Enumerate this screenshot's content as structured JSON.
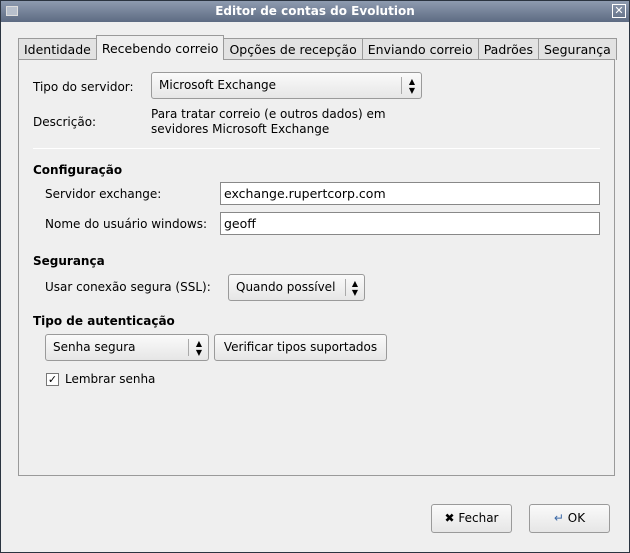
{
  "window": {
    "title": "Editor de contas do Evolution"
  },
  "tabs": [
    "Identidade",
    "Recebendo correio",
    "Opções de recepção",
    "Enviando correio",
    "Padrões",
    "Segurança"
  ],
  "server": {
    "label": "Tipo do servidor:",
    "value": "Microsoft Exchange",
    "desc_label": "Descrição:",
    "desc_line1": "Para tratar correio (e outros dados) em",
    "desc_line2": "sevidores Microsoft Exchange"
  },
  "config": {
    "heading": "Configuração",
    "server_label": "Servidor exchange:",
    "server_value": "exchange.rupertcorp.com",
    "user_label": "Nome do usuário windows:",
    "user_value": "geoff"
  },
  "security": {
    "heading": "Segurança",
    "ssl_label": "Usar conexão segura (SSL):",
    "ssl_value": "Quando possível"
  },
  "auth": {
    "heading": "Tipo de autenticação",
    "type_value": "Senha segura",
    "check_button": "Verificar tipos suportados",
    "remember_label": "Lembrar senha",
    "remember_checked": true
  },
  "buttons": {
    "close": "Fechar",
    "ok": "OK"
  }
}
